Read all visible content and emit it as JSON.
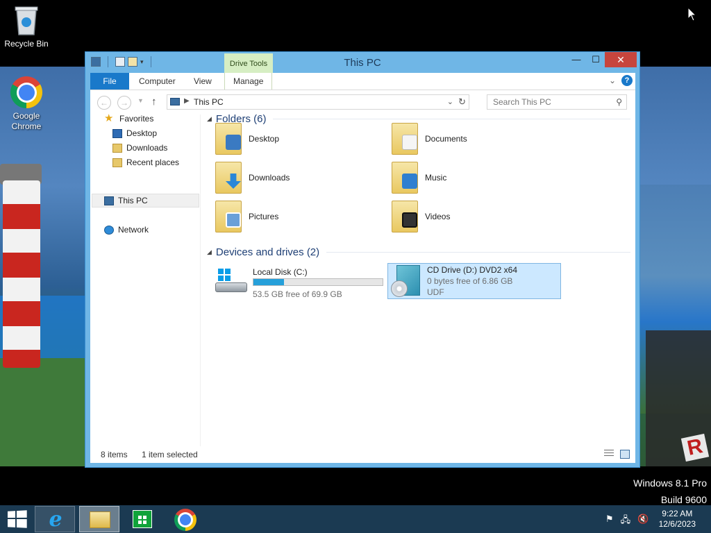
{
  "desktop": {
    "icons": [
      {
        "label": "Recycle Bin",
        "icon": "recycle-bin-icon"
      },
      {
        "label": "Google\nChrome",
        "icon": "chrome-icon"
      }
    ],
    "watermark": {
      "line1": "Windows 8.1 Pro",
      "line2": "Build 9600"
    }
  },
  "window": {
    "title": "This PC",
    "context_tab": "Drive Tools",
    "controls": {
      "minimize": "—",
      "maximize": "☐",
      "close": "✕"
    },
    "ribbon_tabs": [
      {
        "label": "File"
      },
      {
        "label": "Computer"
      },
      {
        "label": "View"
      },
      {
        "label": "Manage"
      }
    ],
    "address": {
      "path": "This PC"
    },
    "search": {
      "placeholder": "Search This PC"
    },
    "nav_pane": {
      "favorites": "Favorites",
      "items": [
        {
          "label": "Desktop"
        },
        {
          "label": "Downloads"
        },
        {
          "label": "Recent places"
        }
      ],
      "this_pc": "This PC",
      "network": "Network"
    },
    "folders_header": "Folders (6)",
    "folders": [
      {
        "label": "Desktop",
        "icon": "desktop-folder-icon"
      },
      {
        "label": "Documents",
        "icon": "documents-folder-icon"
      },
      {
        "label": "Downloads",
        "icon": "downloads-folder-icon"
      },
      {
        "label": "Music",
        "icon": "music-folder-icon"
      },
      {
        "label": "Pictures",
        "icon": "pictures-folder-icon"
      },
      {
        "label": "Videos",
        "icon": "videos-folder-icon"
      }
    ],
    "drives_header": "Devices and drives (2)",
    "drives": [
      {
        "name": "Local Disk (C:)",
        "free": "53.5 GB free of 69.9 GB",
        "used_fraction": 0.235
      },
      {
        "name": "CD Drive (D:) DVD2 x64",
        "free": "0 bytes free of 6.86 GB",
        "fs": "UDF"
      }
    ],
    "status": {
      "items": "8 items",
      "selected": "1 item selected"
    }
  },
  "taskbar": {
    "apps": [
      "internet-explorer-icon",
      "file-explorer-icon",
      "store-icon",
      "chrome-icon"
    ],
    "clock": {
      "time": "9:22 AM",
      "date": "12/6/2023"
    }
  },
  "colors": {
    "accent": "#1979ca",
    "title_bar": "#6fb6e6",
    "taskbar": "#1b3a52",
    "selection": "#cce8ff"
  }
}
